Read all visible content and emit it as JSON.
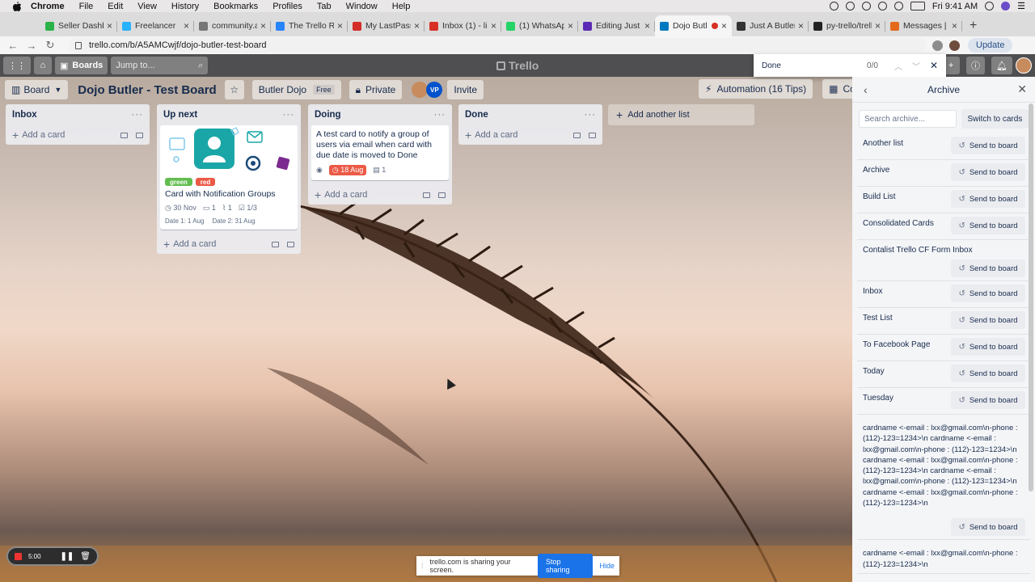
{
  "menubar": {
    "app": "Chrome",
    "items": [
      "File",
      "Edit",
      "View",
      "History",
      "Bookmarks",
      "Profiles",
      "Tab",
      "Window",
      "Help"
    ],
    "clock": "Fri 9:41 AM"
  },
  "tabs": [
    {
      "title": "Seller Dashbo",
      "color": "#2bb34a"
    },
    {
      "title": "Freelancer",
      "color": "#29b2fe"
    },
    {
      "title": "community.at",
      "color": "#777"
    },
    {
      "title": "The Trello RE",
      "color": "#2684ff"
    },
    {
      "title": "My LastPass",
      "color": "#d32d27"
    },
    {
      "title": "Inbox (1) - lin",
      "color": "#d93025"
    },
    {
      "title": "(1) WhatsApp",
      "color": "#25d366"
    },
    {
      "title": "Editing Just a",
      "color": "#5b2bb5"
    },
    {
      "title": "Dojo Butl",
      "color": "#0079bf",
      "active": true
    },
    {
      "title": "Just A Butler",
      "color": "#333"
    },
    {
      "title": "py-trello/trell",
      "color": "#222"
    },
    {
      "title": "Messages | C",
      "color": "#e46a1b"
    }
  ],
  "address": {
    "url": "trello.com/b/A5AMCwjf/dojo-butler-test-board",
    "update_label": "Update"
  },
  "trello_header": {
    "boards_label": "Boards",
    "jump_placeholder": "Jump to...",
    "logo": "Trello"
  },
  "findbar": {
    "query": "Done",
    "count": "0/0"
  },
  "board": {
    "view_label": "Board",
    "title": "Dojo Butler - Test Board",
    "team": "Butler Dojo",
    "team_badge": "Free",
    "visibility": "Private",
    "avatar_initials": "VP",
    "invite_label": "Invite",
    "automation_label": "Automation (16 Tips)",
    "contalist_label": "Contalist"
  },
  "lists": [
    {
      "name": "Inbox",
      "add_label": "Add a card"
    },
    {
      "name": "Up next",
      "add_label": "Add a card",
      "card": {
        "labels": [
          {
            "text": "green",
            "color": "#61bd4f"
          },
          {
            "text": "red",
            "color": "#eb5a46"
          }
        ],
        "title": "Card with Notification Groups",
        "due": "30 Nov",
        "comments": "1",
        "attachments": "1",
        "checklist": "1/3",
        "date1": "Date 1: 1 Aug",
        "date2": "Date 2: 31 Aug"
      }
    },
    {
      "name": "Doing",
      "add_label": "Add a card",
      "card": {
        "title": "A test card to notify a group of users via email when card with due date is moved to Done",
        "due": "18 Aug",
        "attachments": "1"
      }
    },
    {
      "name": "Done",
      "add_label": "Add a card"
    }
  ],
  "add_list_label": "Add another list",
  "archive": {
    "title": "Archive",
    "search_placeholder": "Search archive...",
    "switch_label": "Switch to cards",
    "send_label": "Send to board",
    "items": [
      "Another list",
      "Archive",
      "Build List",
      "Consolidated Cards",
      "Contalist Trello CF Form Inbox",
      "Inbox",
      "Test List",
      "To Facebook Page",
      "Today",
      "Tuesday"
    ],
    "long_item": "cardname <-email : lxx@gmail.com\\n-phone : (112)-123=1234>\\n cardname <-email : lxx@gmail.com\\n-phone : (112)-123=1234>\\n cardname <-email : lxx@gmail.com\\n-phone : (112)-123=1234>\\n cardname <-email : lxx@gmail.com\\n-phone : (112)-123=1234>\\n cardname <-email : lxx@gmail.com\\n-phone : (112)-123=1234>\\n",
    "long_item_2": "cardname <-email : lxx@gmail.com\\n-phone : (112)-123=1234>\\n"
  },
  "recorder": {
    "time": "5:00"
  },
  "share": {
    "message": "trello.com is sharing your screen.",
    "stop_label": "Stop sharing",
    "hide_label": "Hide"
  }
}
